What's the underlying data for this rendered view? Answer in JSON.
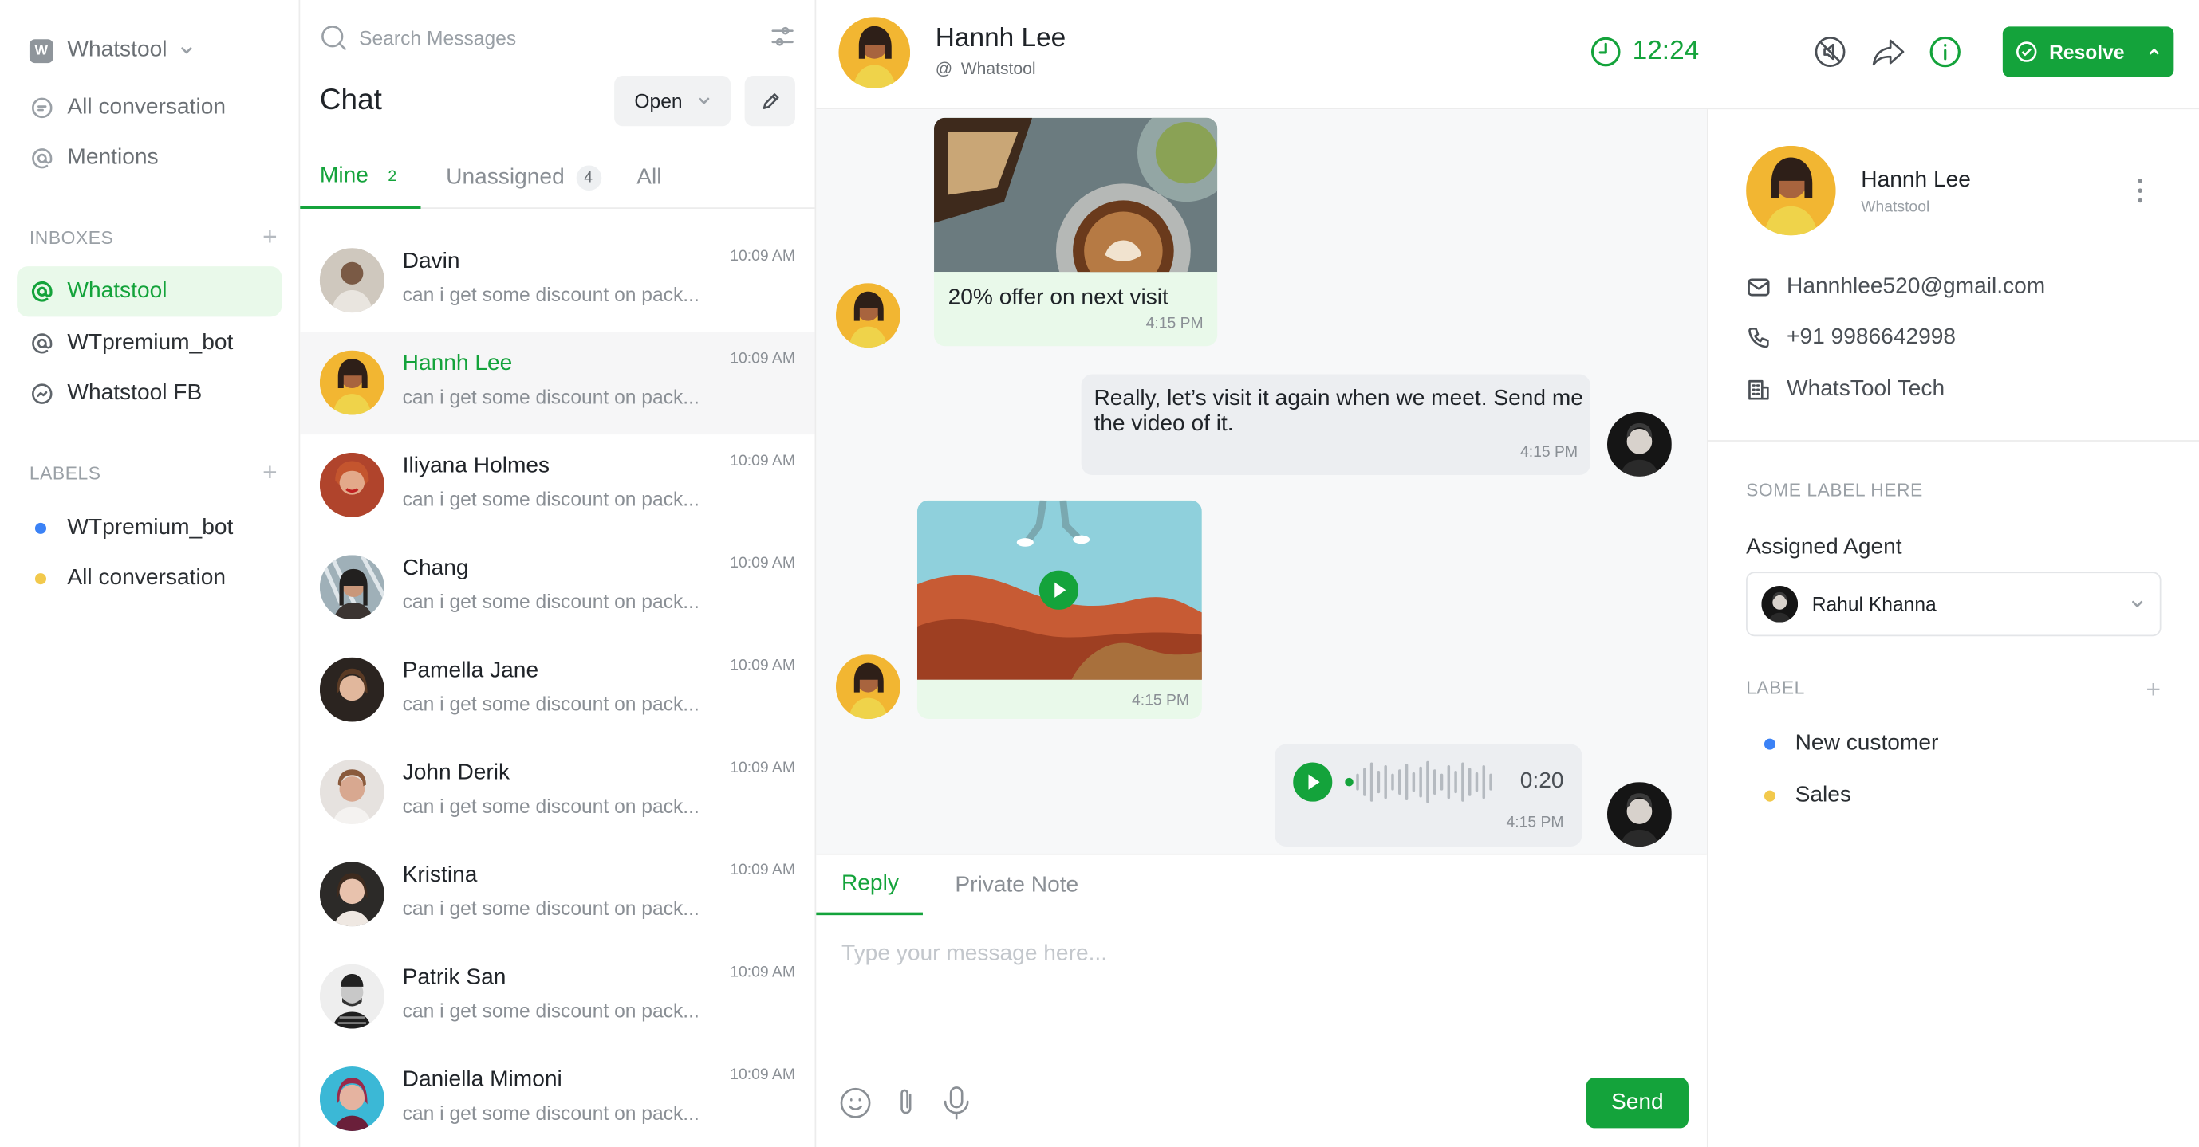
{
  "sidebar": {
    "workspace": {
      "letter": "W",
      "name": "Whatstool"
    },
    "nav": [
      {
        "label": "All conversation",
        "icon": "chat-bubble-icon"
      },
      {
        "label": "Mentions",
        "icon": "at-icon"
      }
    ],
    "inboxes_title": "INBOXES",
    "inboxes": [
      {
        "label": "Whatstool",
        "icon": "at-icon",
        "active": true
      },
      {
        "label": "WTpremium_bot",
        "icon": "at-icon"
      },
      {
        "label": "Whatstool FB",
        "icon": "messenger-icon"
      }
    ],
    "labels_title": "LABELS",
    "labels": [
      {
        "label": "WTpremium_bot",
        "color": "#3b82f6"
      },
      {
        "label": "All conversation",
        "color": "#f2c94c"
      }
    ]
  },
  "chatlist": {
    "search_placeholder": "Search Messages",
    "title": "Chat",
    "status_filter": "Open",
    "tabs": [
      {
        "label": "Mine",
        "count": "2"
      },
      {
        "label": "Unassigned",
        "count": "4"
      },
      {
        "label": "All",
        "count": ""
      }
    ],
    "items": [
      {
        "name": "Davin",
        "preview": "can i get some discount on pack...",
        "time": "10:09 AM"
      },
      {
        "name": "Hannh Lee",
        "preview": "can i get some discount on pack...",
        "time": "10:09 AM"
      },
      {
        "name": "Iliyana Holmes",
        "preview": "can i get some discount on pack...",
        "time": "10:09 AM"
      },
      {
        "name": "Chang",
        "preview": "can i get some discount on pack...",
        "time": "10:09 AM"
      },
      {
        "name": "Pamella Jane",
        "preview": "can i get some discount on pack...",
        "time": "10:09 AM"
      },
      {
        "name": "John Derik",
        "preview": "can i get some discount on pack...",
        "time": "10:09 AM"
      },
      {
        "name": "Kristina",
        "preview": "can i get some discount on pack...",
        "time": "10:09 AM"
      },
      {
        "name": "Patrik San",
        "preview": "can i get some discount on pack...",
        "time": "10:09 AM"
      },
      {
        "name": "Daniella Mimoni",
        "preview": "can i get some discount on pack...",
        "time": "10:09 AM"
      }
    ]
  },
  "conversation": {
    "contact_name": "Hannh Lee",
    "contact_inbox": "Whatstool",
    "timer": "12:24",
    "resolve_label": "Resolve",
    "messages": [
      {
        "text": "20% offer on next visit",
        "time": "4:15 PM"
      },
      {
        "text": "Really, let’s visit it again when we meet. Send me the video of it.",
        "time": "4:15 PM"
      },
      {
        "time": "4:15 PM"
      },
      {
        "duration": "0:20",
        "time": "4:15 PM"
      }
    ],
    "reply_tabs": [
      "Reply",
      "Private Note"
    ],
    "input_placeholder": "Type your message here...",
    "send_label": "Send"
  },
  "contact_panel": {
    "name": "Hannh Lee",
    "inbox": "Whatstool",
    "email": "Hannhlee520@gmail.com",
    "phone": "+91 9986642998",
    "company": "WhatsTool Tech",
    "section_label": "SOME LABEL HERE",
    "assigned_agent_label": "Assigned Agent",
    "assigned_agent": "Rahul Khanna",
    "label_title": "LABEL",
    "labels": [
      {
        "label": "New customer",
        "color": "#3b82f6"
      },
      {
        "label": "Sales",
        "color": "#f2c94c"
      }
    ]
  },
  "colors": {
    "accent": "#14a33b",
    "accent_light": "#e9f9ea"
  }
}
